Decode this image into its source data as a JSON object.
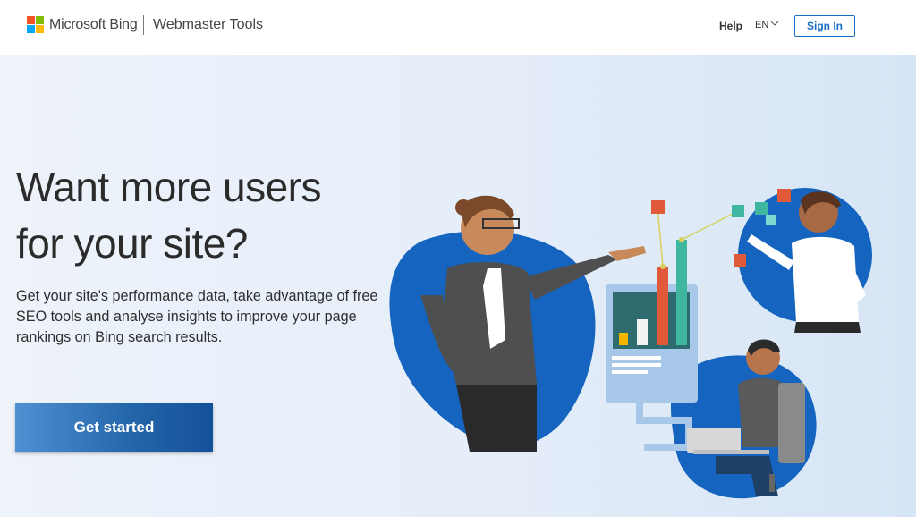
{
  "header": {
    "brand": "Microsoft Bing",
    "product": "Webmaster Tools",
    "help_label": "Help",
    "language": "EN",
    "signin_label": "Sign In"
  },
  "hero": {
    "headline_line1": "Want more users",
    "headline_line2": "for your site?",
    "description": "Get your site's performance data, take advantage of free SEO tools and analyse insights to improve your page rankings on Bing search results.",
    "cta_label": "Get started"
  },
  "colors": {
    "accent": "#1a6fc4",
    "blob": "#1565c0",
    "logo_red": "#f35325",
    "logo_green": "#81bc06",
    "logo_blue": "#05a6f0",
    "logo_yellow": "#ffba08"
  },
  "icons": [
    "microsoft-logo-icon",
    "chevron-down-icon",
    "hero-illustration"
  ]
}
